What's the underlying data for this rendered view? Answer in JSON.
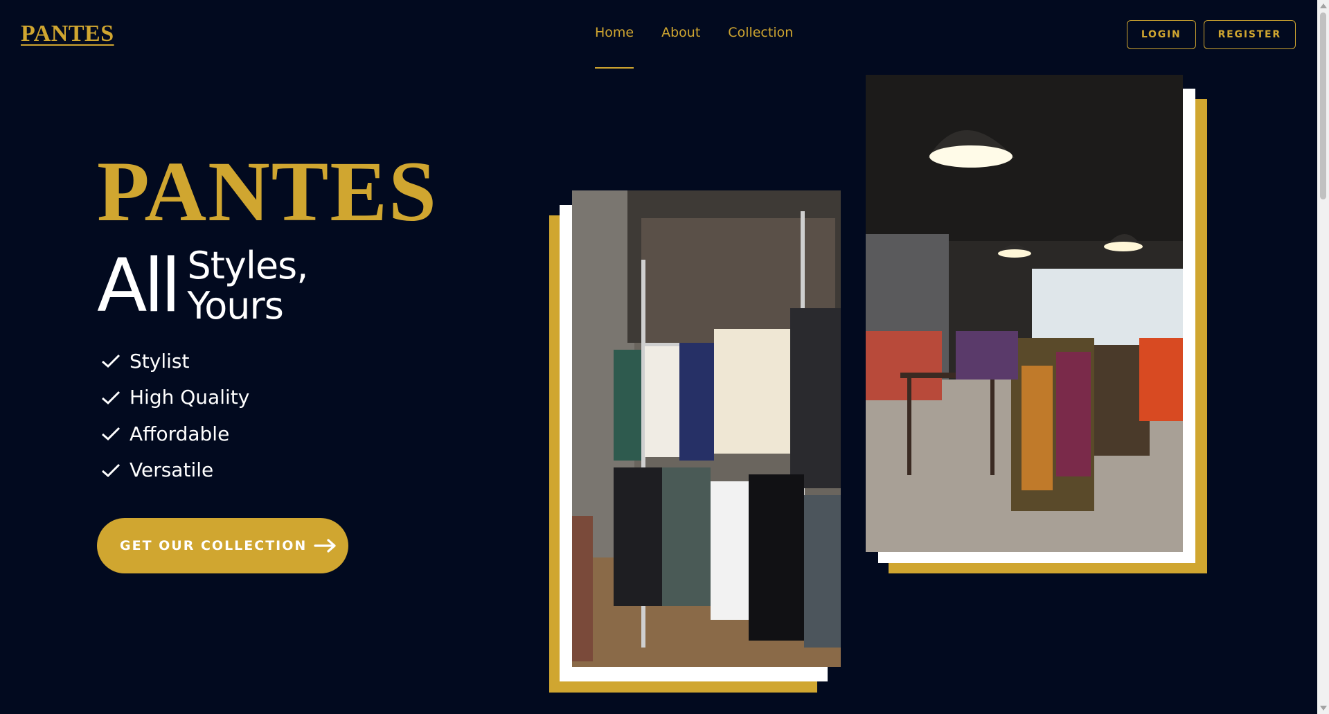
{
  "header": {
    "logo": "PANTES",
    "nav": [
      {
        "label": "Home",
        "active": true
      },
      {
        "label": "About",
        "active": false
      },
      {
        "label": "Collection",
        "active": false
      }
    ],
    "login_label": "LOGIN",
    "register_label": "REGISTER"
  },
  "hero": {
    "title": "PANTES",
    "tagline_big": "All",
    "tagline_line1": "Styles,",
    "tagline_line2": "Yours",
    "features": [
      "Stylist",
      "High Quality",
      "Affordable",
      "Versatile"
    ],
    "cta_label": "GET OUR COLLECTION"
  },
  "colors": {
    "background": "#020a1f",
    "accent": "#d0a630",
    "text": "#ffffff"
  },
  "icons": {
    "check": "check-icon",
    "cta": "arrow-right-icon"
  },
  "images": {
    "left": "clothing-rack-photo",
    "right": "store-interior-photo"
  }
}
